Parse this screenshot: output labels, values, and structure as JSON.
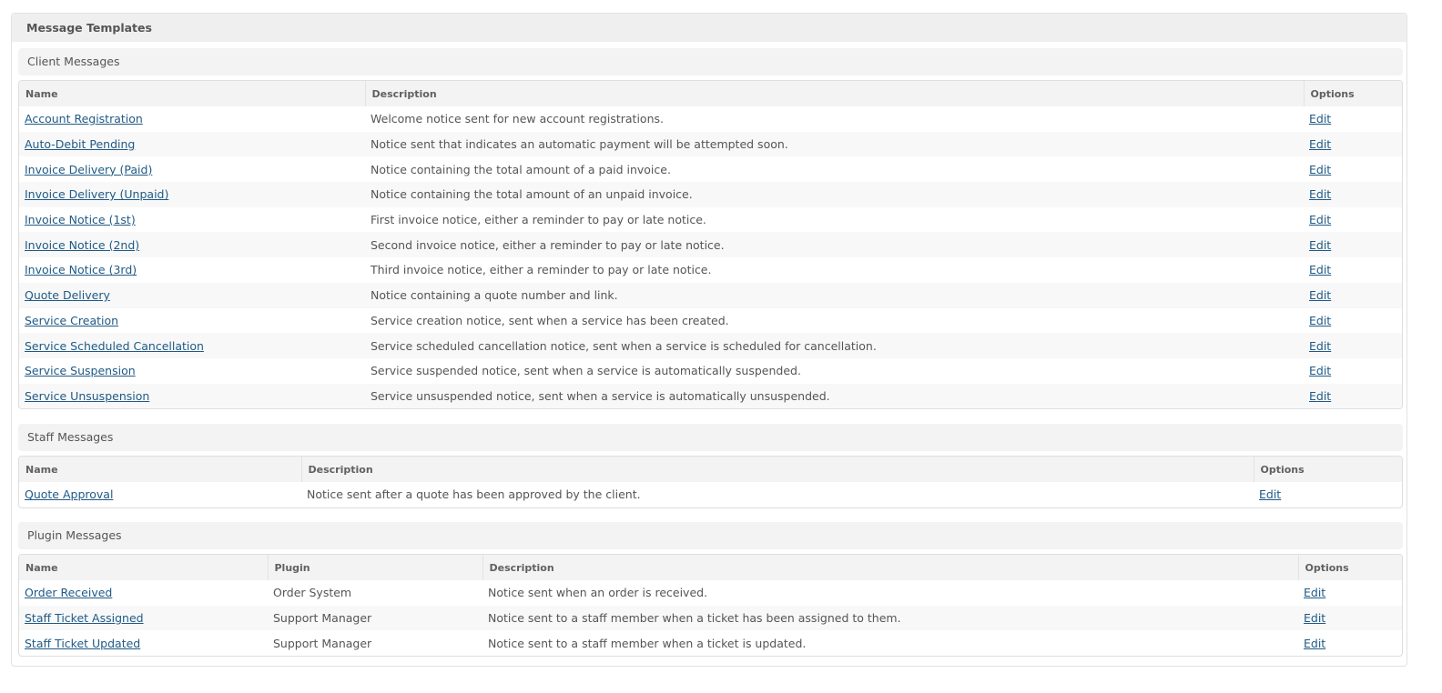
{
  "panel": {
    "title": "Message Templates"
  },
  "client": {
    "title": "Client Messages",
    "headers": {
      "name": "Name",
      "description": "Description",
      "options": "Options"
    },
    "rows": [
      {
        "name": "Account Registration",
        "description": "Welcome notice sent for new account registrations.",
        "action": "Edit"
      },
      {
        "name": "Auto-Debit Pending",
        "description": "Notice sent that indicates an automatic payment will be attempted soon.",
        "action": "Edit"
      },
      {
        "name": "Invoice Delivery (Paid)",
        "description": "Notice containing the total amount of a paid invoice.",
        "action": "Edit"
      },
      {
        "name": "Invoice Delivery (Unpaid)",
        "description": "Notice containing the total amount of an unpaid invoice.",
        "action": "Edit"
      },
      {
        "name": "Invoice Notice (1st)",
        "description": "First invoice notice, either a reminder to pay or late notice.",
        "action": "Edit"
      },
      {
        "name": "Invoice Notice (2nd)",
        "description": "Second invoice notice, either a reminder to pay or late notice.",
        "action": "Edit"
      },
      {
        "name": "Invoice Notice (3rd)",
        "description": "Third invoice notice, either a reminder to pay or late notice.",
        "action": "Edit"
      },
      {
        "name": "Quote Delivery",
        "description": "Notice containing a quote number and link.",
        "action": "Edit"
      },
      {
        "name": "Service Creation",
        "description": "Service creation notice, sent when a service has been created.",
        "action": "Edit"
      },
      {
        "name": "Service Scheduled Cancellation",
        "description": "Service scheduled cancellation notice, sent when a service is scheduled for cancellation.",
        "action": "Edit"
      },
      {
        "name": "Service Suspension",
        "description": "Service suspended notice, sent when a service is automatically suspended.",
        "action": "Edit"
      },
      {
        "name": "Service Unsuspension",
        "description": "Service unsuspended notice, sent when a service is automatically unsuspended.",
        "action": "Edit"
      }
    ]
  },
  "staff": {
    "title": "Staff Messages",
    "headers": {
      "name": "Name",
      "description": "Description",
      "options": "Options"
    },
    "rows": [
      {
        "name": "Quote Approval",
        "description": "Notice sent after a quote has been approved by the client.",
        "action": "Edit"
      }
    ]
  },
  "plugin": {
    "title": "Plugin Messages",
    "headers": {
      "name": "Name",
      "plugin": "Plugin",
      "description": "Description",
      "options": "Options"
    },
    "rows": [
      {
        "name": "Order Received",
        "plugin": "Order System",
        "description": "Notice sent when an order is received.",
        "action": "Edit"
      },
      {
        "name": "Staff Ticket Assigned",
        "plugin": "Support Manager",
        "description": "Notice sent to a staff member when a ticket has been assigned to them.",
        "action": "Edit"
      },
      {
        "name": "Staff Ticket Updated",
        "plugin": "Support Manager",
        "description": "Notice sent to a staff member when a ticket is updated.",
        "action": "Edit"
      }
    ]
  }
}
